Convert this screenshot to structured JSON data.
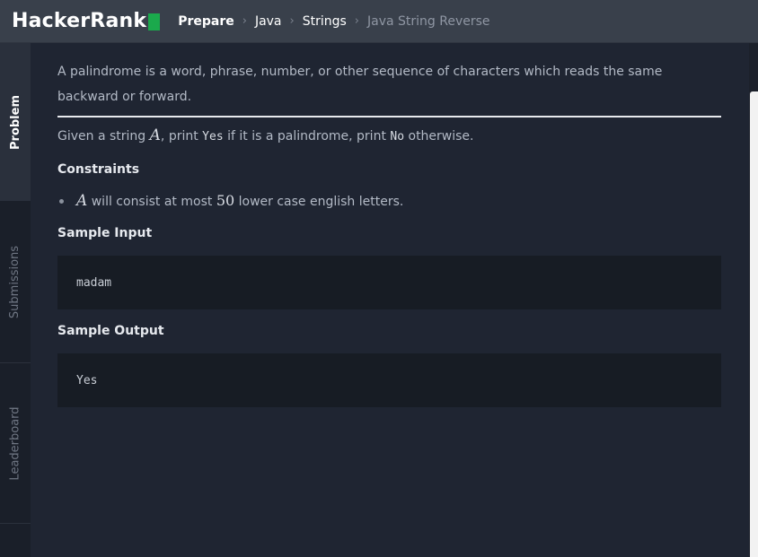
{
  "header": {
    "logo_text": "HackerRank",
    "breadcrumbs": [
      "Prepare",
      "Java",
      "Strings",
      "Java String Reverse"
    ],
    "separator": "›"
  },
  "sidebar": {
    "tabs": [
      {
        "label": "Problem",
        "active": true
      },
      {
        "label": "Submissions",
        "active": false
      },
      {
        "label": "Leaderboard",
        "active": false
      }
    ]
  },
  "problem": {
    "intro": "A palindrome is a word, phrase, number, or other sequence of characters which reads the same backward or forward.",
    "task_prefix": "Given a string ",
    "task_var": "A",
    "task_mid1": ", print ",
    "task_yes": "Yes",
    "task_mid2": " if it is a palindrome, print ",
    "task_no": "No",
    "task_suffix": " otherwise.",
    "constraints_heading": "Constraints",
    "constraint_var": "A",
    "constraint_mid": " will consist at most ",
    "constraint_num": "50",
    "constraint_suffix": " lower case english letters.",
    "sample_input_heading": "Sample Input",
    "sample_input": "madam",
    "sample_output_heading": "Sample Output",
    "sample_output": "Yes"
  },
  "colors": {
    "brand_green": "#1ba94c",
    "topbar": "#39404b",
    "background": "#1f2532"
  }
}
